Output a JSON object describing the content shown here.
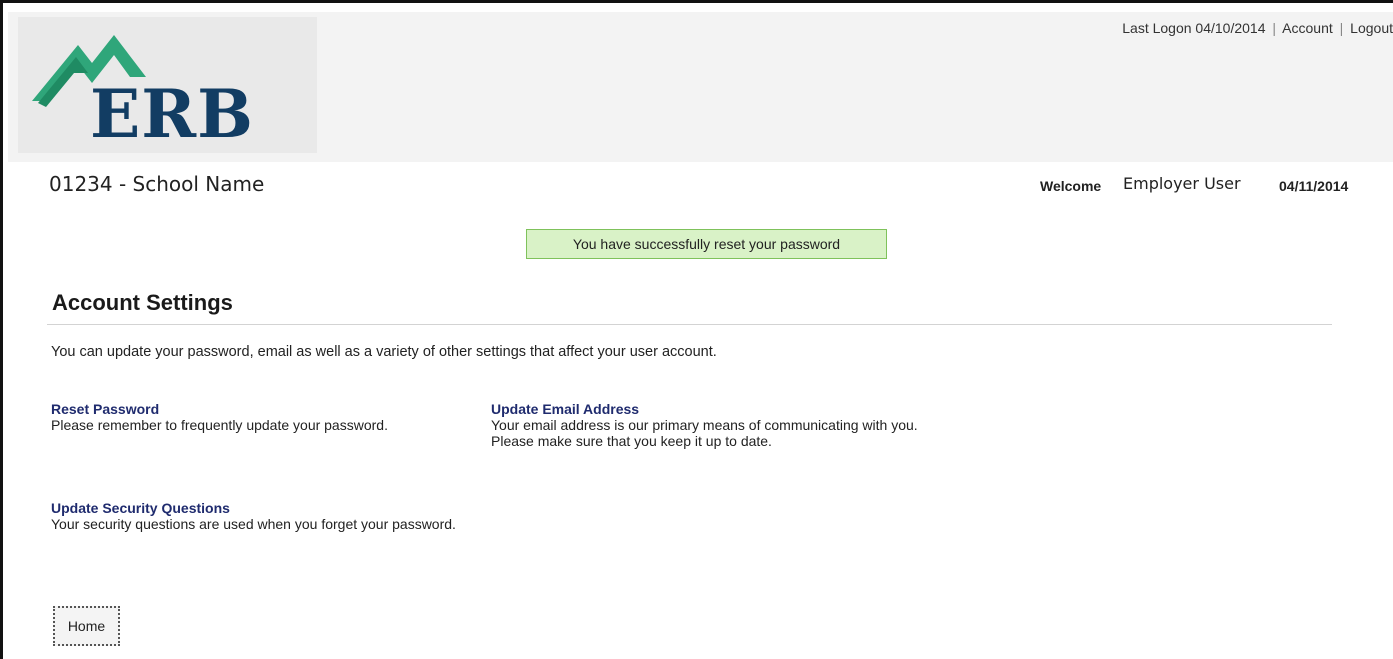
{
  "header": {
    "logo_text": "ERB",
    "last_logon": "Last Logon 04/10/2014",
    "account_link": "Account",
    "logout_link": "Logout",
    "separator": "|"
  },
  "context": {
    "school": "01234 - School Name",
    "welcome_label": "Welcome",
    "user_name": "Employer User",
    "date": "04/11/2014"
  },
  "alert": {
    "message": "You have successfully reset your password"
  },
  "main": {
    "title": "Account Settings",
    "intro": "You can update your password, email as well as a variety of other settings that affect your user account.",
    "sections": [
      {
        "link": "Reset Password",
        "description": "Please remember to frequently update your password."
      },
      {
        "link": "Update Email Address",
        "description": "Your email address is our primary means of communicating with you. Please make sure that you keep it up to date."
      },
      {
        "link": "Update Security Questions",
        "description": "Your security questions are used when you forget your password."
      }
    ],
    "home_button": "Home"
  },
  "colors": {
    "logo_navy": "#123d63",
    "logo_teal": "#2fa67a",
    "link_blue": "#1f2b6e",
    "success_bg": "#d9f2c7",
    "success_border": "#7fc25b"
  }
}
